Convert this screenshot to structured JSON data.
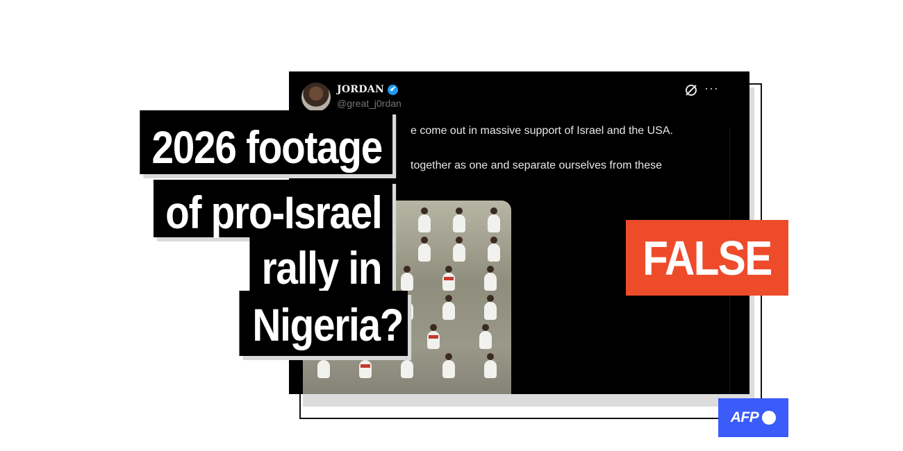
{
  "tweet": {
    "author_name": "JORDAN",
    "author_handle": "@great_j0rdan",
    "verified_glyph": "✔",
    "more_glyph": "···",
    "line1": "e come out in massive support of Israel and the USA.",
    "line2": "together as one and separate ourselves from these",
    "icons": [
      "verified-badge-icon",
      "grok-icon",
      "more-options-icon"
    ]
  },
  "headline": {
    "line1": "2026 footage",
    "line2": "of pro-Israel",
    "line3": "rally in",
    "line4": "Nigeria?"
  },
  "verdict": {
    "label": "FALSE",
    "color": "#ee4b2b"
  },
  "logo": {
    "text": "AFP",
    "color": "#3b5bfa"
  }
}
